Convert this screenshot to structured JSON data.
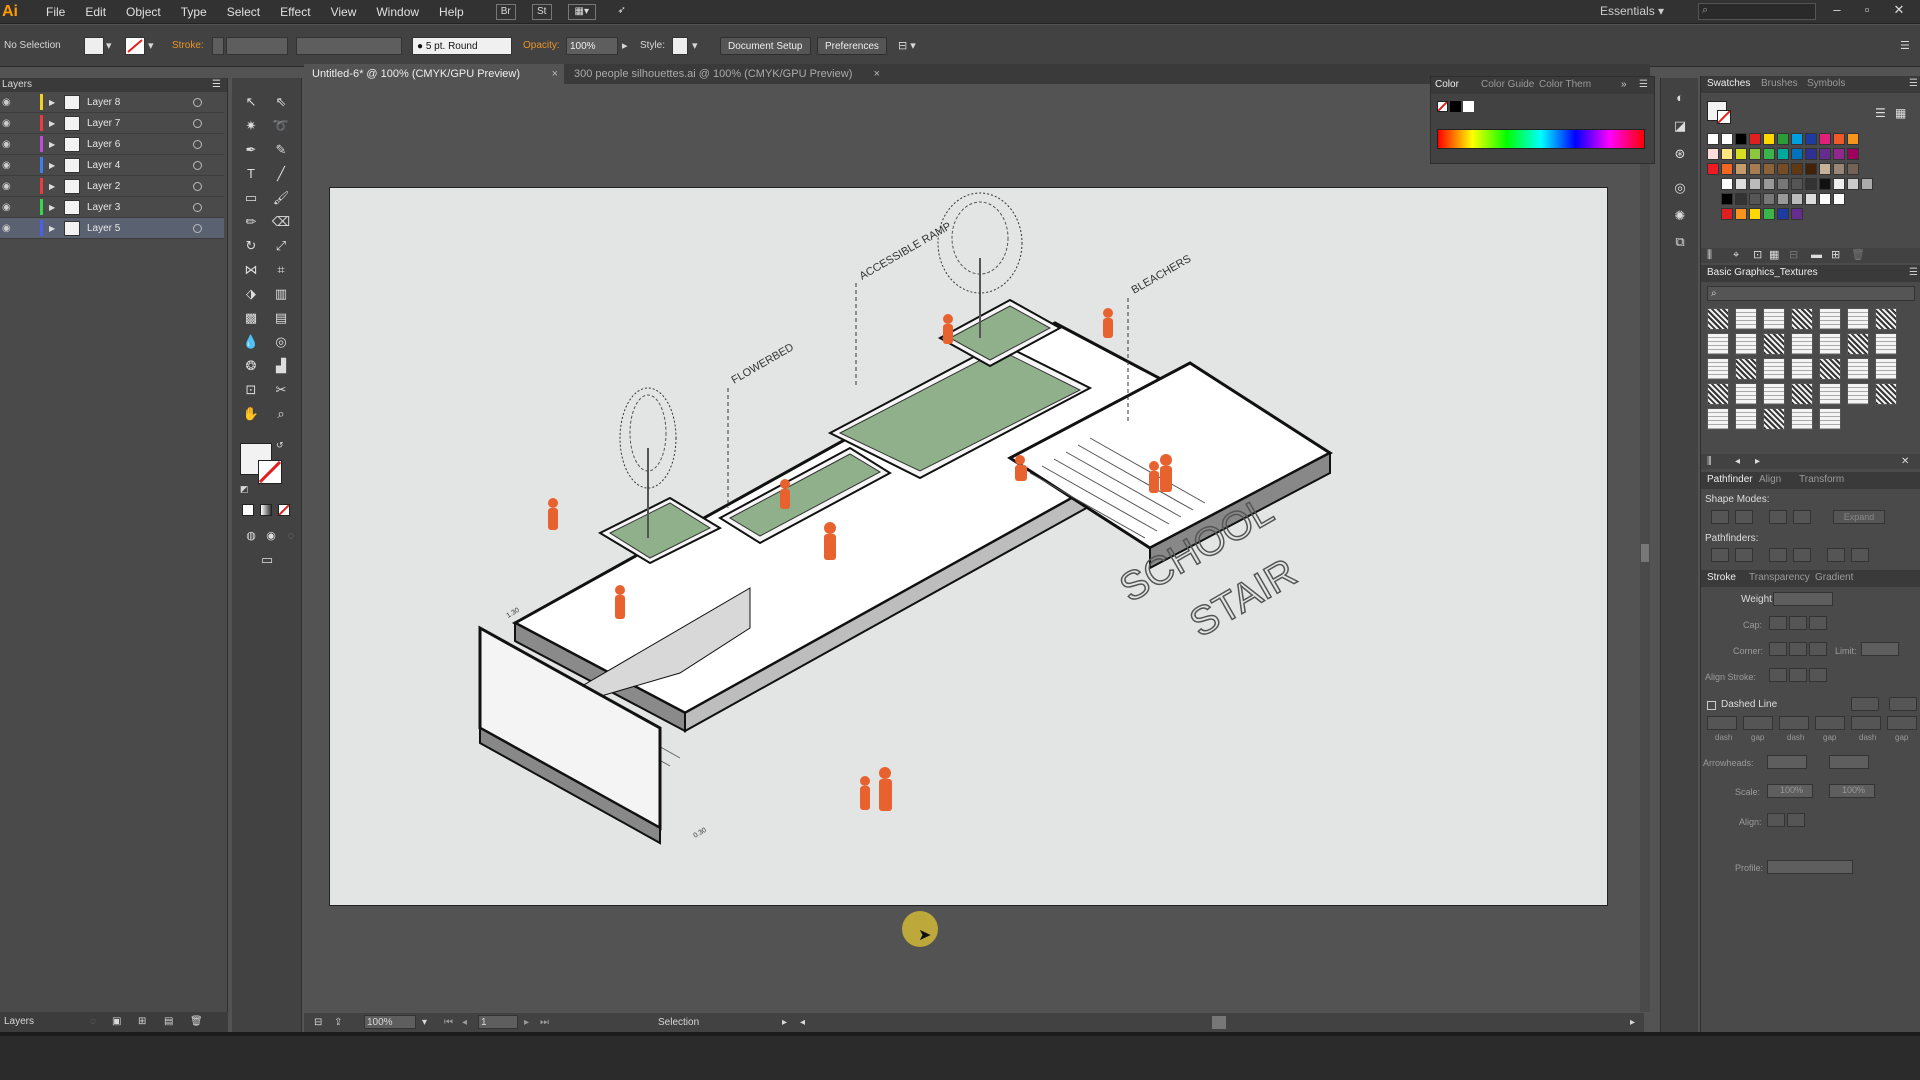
{
  "app": {
    "logo": "Ai"
  },
  "menu": [
    "File",
    "Edit",
    "Object",
    "Type",
    "Select",
    "Effect",
    "View",
    "Window",
    "Help"
  ],
  "menu_buttons": [
    "Br",
    "St"
  ],
  "workspace": "Essentials",
  "control": {
    "selection": "No Selection",
    "stroke_label": "Stroke:",
    "brush": "5 pt. Round",
    "opacity_label": "Opacity:",
    "opacity_value": "100%",
    "style_label": "Style:",
    "doc_setup": "Document Setup",
    "preferences": "Preferences"
  },
  "layers": {
    "title": "Layers",
    "footer": "Layers",
    "items": [
      {
        "name": "Layer 8",
        "color": "#f2d21e"
      },
      {
        "name": "Layer 7",
        "color": "#ef3b3b"
      },
      {
        "name": "Layer 6",
        "color": "#c04dd9"
      },
      {
        "name": "Layer 4",
        "color": "#3d7df0"
      },
      {
        "name": "Layer 2",
        "color": "#ef3b3b"
      },
      {
        "name": "Layer 3",
        "color": "#33d94a"
      },
      {
        "name": "Layer 5",
        "color": "#4a5ef2"
      }
    ],
    "selected_index": 6
  },
  "tabs": [
    {
      "label": "Untitled-6* @ 100% (CMYK/GPU Preview)",
      "active": true
    },
    {
      "label": "300 people silhouettes.ai @ 100% (CMYK/GPU Preview)",
      "active": false
    }
  ],
  "drawing": {
    "labels": [
      "ACCESSIBLE RAMP",
      "FLOWERBED",
      "BLEACHERS"
    ],
    "title_line1": "SCHOOL",
    "title_line2": "STAIR",
    "dim1": "1.30",
    "dim2": "0.30",
    "accent_color": "#e8622f",
    "grass_color": "#8fb08a"
  },
  "status": {
    "zoom": "100%",
    "page": "1",
    "tool": "Selection"
  },
  "color_panel": {
    "tabs": [
      "Color",
      "Color Guide",
      "Color Them"
    ]
  },
  "swatches_panel": {
    "tabs": [
      "Swatches",
      "Brushes",
      "Symbols"
    ],
    "library": "Basic Graphics_Textures"
  },
  "pathfinder_panel": {
    "tabs": [
      "Pathfinder",
      "Align",
      "Transform"
    ],
    "shape_modes": "Shape Modes:",
    "expand": "Expand",
    "pathfinders": "Pathfinders:"
  },
  "stroke_panel": {
    "tabs": [
      "Stroke",
      "Transparency",
      "Gradient"
    ],
    "weight": "Weight:",
    "cap": "Cap:",
    "corner": "Corner:",
    "limit": "Limit:",
    "align_stroke": "Align Stroke:",
    "dashed": "Dashed Line",
    "dash_labels": [
      "dash",
      "gap",
      "dash",
      "gap",
      "dash",
      "gap"
    ],
    "arrowheads": "Arrowheads:",
    "scale": "Scale:",
    "scale_a": "100%",
    "scale_b": "100%",
    "align": "Align:",
    "profile": "Profile:"
  }
}
